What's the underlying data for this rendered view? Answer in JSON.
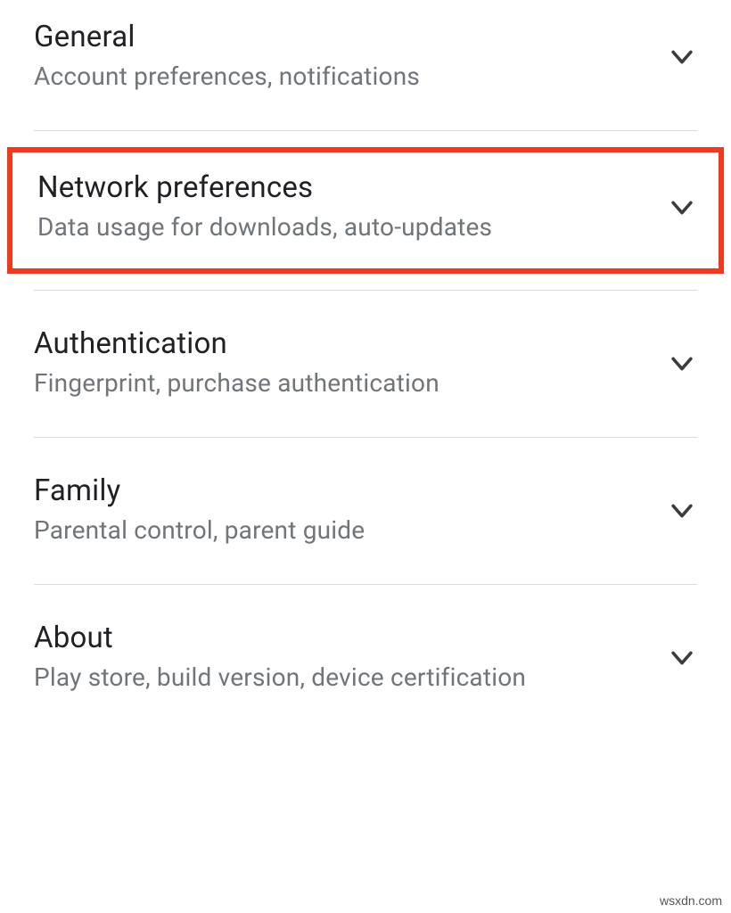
{
  "settings": {
    "items": [
      {
        "title": "General",
        "subtitle": "Account preferences, notifications"
      },
      {
        "title": "Network preferences",
        "subtitle": "Data usage for downloads, auto-updates"
      },
      {
        "title": "Authentication",
        "subtitle": "Fingerprint, purchase authentication"
      },
      {
        "title": "Family",
        "subtitle": "Parental control, parent guide"
      },
      {
        "title": "About",
        "subtitle": "Play store, build version, device certification"
      }
    ]
  },
  "watermark": "wsxdn.com"
}
